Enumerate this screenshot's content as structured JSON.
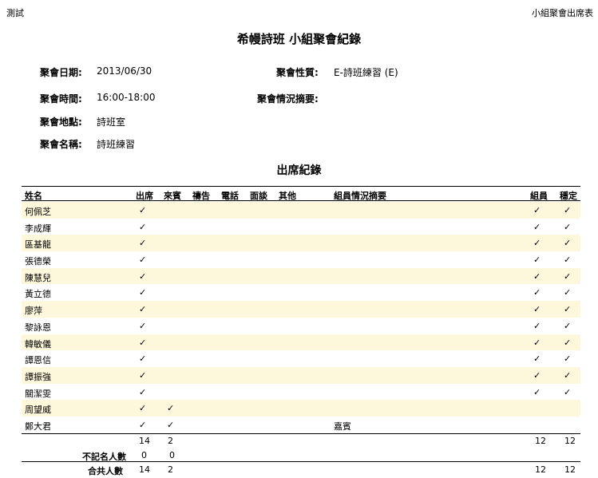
{
  "header": {
    "left": "測試",
    "right": "小組聚會出席表",
    "title": "希幔詩班 小組聚會紀錄",
    "attendance_title": "出席紀錄"
  },
  "info": {
    "date_label": "聚會日期:",
    "date": "2013/06/30",
    "time_label": "聚會時間:",
    "time": "16:00-18:00",
    "place_label": "聚會地點:",
    "place": "詩班室",
    "name_label": "聚會名稱:",
    "name": "詩班練習",
    "nature_label": "聚會性質:",
    "nature": "E-詩班練習 (E)",
    "summary_label": "聚會情況摘要:"
  },
  "columns": {
    "name": "姓名",
    "attend": "出席",
    "guest": "來賓",
    "broadcast": "禱告",
    "phone": "電話",
    "interview": "面談",
    "other": "其他",
    "notes": "組員情況摘要",
    "member": "組員",
    "stable": "穩定"
  },
  "rows": [
    {
      "name": "何佩芝",
      "attend": "✓",
      "guest": "",
      "notes": "",
      "member": "✓",
      "stable": "✓"
    },
    {
      "name": "李成輝",
      "attend": "✓",
      "guest": "",
      "notes": "",
      "member": "✓",
      "stable": "✓"
    },
    {
      "name": "區基龍",
      "attend": "✓",
      "guest": "",
      "notes": "",
      "member": "✓",
      "stable": "✓"
    },
    {
      "name": "張德榮",
      "attend": "✓",
      "guest": "",
      "notes": "",
      "member": "✓",
      "stable": "✓"
    },
    {
      "name": "陳慧兒",
      "attend": "✓",
      "guest": "",
      "notes": "",
      "member": "✓",
      "stable": "✓"
    },
    {
      "name": "黃立德",
      "attend": "✓",
      "guest": "",
      "notes": "",
      "member": "✓",
      "stable": "✓"
    },
    {
      "name": "廖萍",
      "attend": "✓",
      "guest": "",
      "notes": "",
      "member": "✓",
      "stable": "✓"
    },
    {
      "name": "黎詠恩",
      "attend": "✓",
      "guest": "",
      "notes": "",
      "member": "✓",
      "stable": "✓"
    },
    {
      "name": "韓敏儀",
      "attend": "✓",
      "guest": "",
      "notes": "",
      "member": "✓",
      "stable": "✓"
    },
    {
      "name": "譚恩信",
      "attend": "✓",
      "guest": "",
      "notes": "",
      "member": "✓",
      "stable": "✓"
    },
    {
      "name": "譚振強",
      "attend": "✓",
      "guest": "",
      "notes": "",
      "member": "✓",
      "stable": "✓"
    },
    {
      "name": "關潔雯",
      "attend": "✓",
      "guest": "",
      "notes": "",
      "member": "✓",
      "stable": "✓"
    },
    {
      "name": "周望威",
      "attend": "✓",
      "guest": "✓",
      "notes": "",
      "member": "",
      "stable": ""
    },
    {
      "name": "鄭大君",
      "attend": "✓",
      "guest": "✓",
      "notes": "嘉賓",
      "member": "",
      "stable": ""
    }
  ],
  "totals": {
    "sub_attend": "14",
    "sub_guest": "2",
    "sub_member": "12",
    "sub_stable": "12",
    "anon_label": "不記名人數",
    "anon_attend": "0",
    "anon_guest": "0",
    "total_label": "合共人數",
    "total_attend": "14",
    "total_guest": "2",
    "total_member": "12",
    "total_stable": "12"
  }
}
